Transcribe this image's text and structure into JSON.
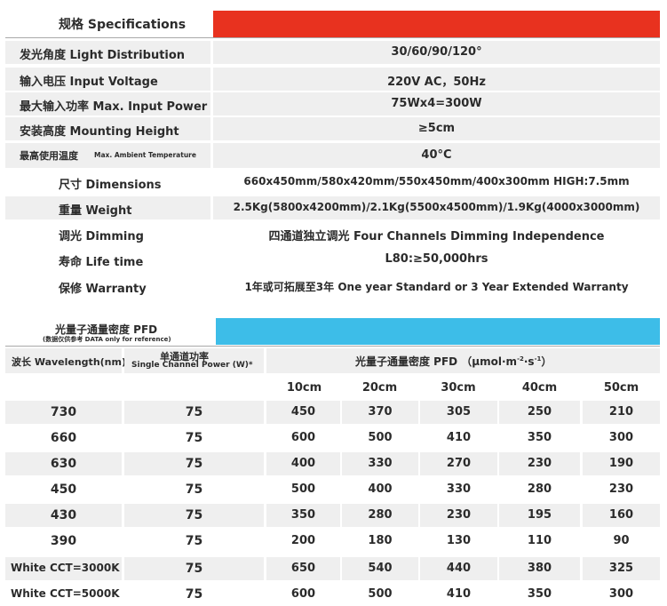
{
  "spec_section": {
    "title": "规格 Specifications",
    "rows": [
      {
        "label": "发光角度 Light Distribution",
        "value": "30/60/90/120°"
      },
      {
        "label": "输入电压 Input Voltage",
        "value": "220V AC，50Hz"
      },
      {
        "label": "最大输入功率 Max. Input Power",
        "value": "75Wx4=300W"
      },
      {
        "label": "安装高度 Mounting Height",
        "value": "≥5cm"
      },
      {
        "label": "最高使用温度",
        "label_small": "Max. Ambient Temperature",
        "value": "40°C"
      },
      {
        "label": "尺寸 Dimensions",
        "value": "660x450mm/580x420mm/550x450mm/400x300mm HIGH:7.5mm"
      },
      {
        "label": "重量 Weight",
        "value": "2.5Kg(5800x4200mm)/2.1Kg(5500x4500mm)/1.9Kg(4000x3000mm)"
      },
      {
        "label": "调光 Dimming",
        "value": "四通道独立调光 Four Channels Dimming Independence"
      },
      {
        "label": "寿命 Life time",
        "value": "L80:≥50,000hrs"
      },
      {
        "label": "保修 Warranty",
        "value": "1年或可拓展至3年 One year Standard or 3 Year Extended Warranty"
      }
    ]
  },
  "pfd_section": {
    "title": "光量子通量密度 PFD",
    "subtitle": "(数据仅供参考 DATA only for reference)",
    "col_wavelength": "波长 Wavelength(nm)",
    "col_power_cn": "单通道功率",
    "col_power_en": "Single Channel Power (W)*",
    "col_pfd": "光量子通量密度 PFD （μmol·m",
    "col_pfd_sup1": "-2",
    "col_pfd_mid": "·s",
    "col_pfd_sup2": "-1",
    "col_pfd_end": "）",
    "distances": [
      "10cm",
      "20cm",
      "30cm",
      "40cm",
      "50cm"
    ],
    "rows": [
      {
        "wavelength": "730",
        "power": "75",
        "values": [
          "450",
          "370",
          "305",
          "250",
          "210"
        ]
      },
      {
        "wavelength": "660",
        "power": "75",
        "values": [
          "600",
          "500",
          "410",
          "350",
          "300"
        ]
      },
      {
        "wavelength": "630",
        "power": "75",
        "values": [
          "400",
          "330",
          "270",
          "230",
          "190"
        ]
      },
      {
        "wavelength": "450",
        "power": "75",
        "values": [
          "500",
          "400",
          "330",
          "280",
          "230"
        ]
      },
      {
        "wavelength": "430",
        "power": "75",
        "values": [
          "350",
          "280",
          "230",
          "195",
          "160"
        ]
      },
      {
        "wavelength": "390",
        "power": "75",
        "values": [
          "200",
          "180",
          "130",
          "110",
          "90"
        ]
      },
      {
        "wavelength": "White CCT=3000K",
        "power": "75",
        "values": [
          "650",
          "540",
          "440",
          "380",
          "325"
        ]
      },
      {
        "wavelength": "White CCT=5000K",
        "power": "75",
        "values": [
          "600",
          "500",
          "410",
          "350",
          "300"
        ]
      }
    ]
  }
}
